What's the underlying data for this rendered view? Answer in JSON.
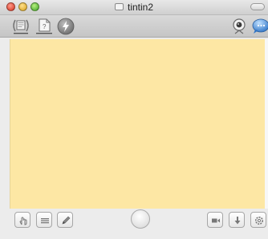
{
  "window": {
    "title": "tintin2"
  },
  "toolbar": {
    "items": [
      {
        "icon": "broadcast-screen-icon"
      },
      {
        "icon": "document-question-icon"
      },
      {
        "icon": "lightning-icon"
      },
      {
        "icon": "webcam-icon"
      },
      {
        "icon": "chat-bubble-icon"
      }
    ]
  },
  "canvas": {
    "background": "#fde7a4"
  },
  "bottombar": {
    "left_buttons": [
      "pointer-hand-icon",
      "text-lines-icon",
      "pencil-icon"
    ],
    "center_button": "record-circle-icon",
    "right_buttons": [
      "video-camera-icon",
      "download-arrow-icon",
      "settings-gear-icon"
    ]
  },
  "colors": {
    "canvas": "#fde7a4",
    "chat_accent": "#4a90d9"
  }
}
